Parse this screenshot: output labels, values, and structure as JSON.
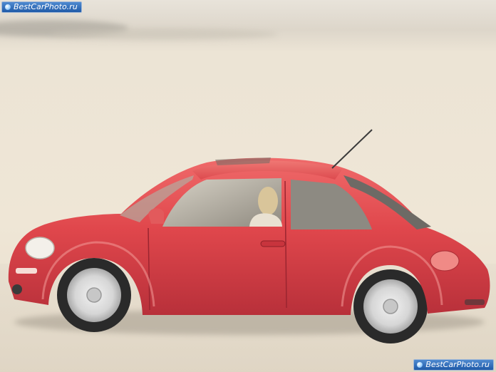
{
  "watermark": {
    "top_left": "BestCarPhoto.ru",
    "bottom_right": "BestCarPhoto.ru"
  },
  "colors": {
    "body_red": "#e0474c",
    "body_red_dark": "#b8303a",
    "sand": "#ece3d3",
    "sky": "#e9e4dc"
  }
}
